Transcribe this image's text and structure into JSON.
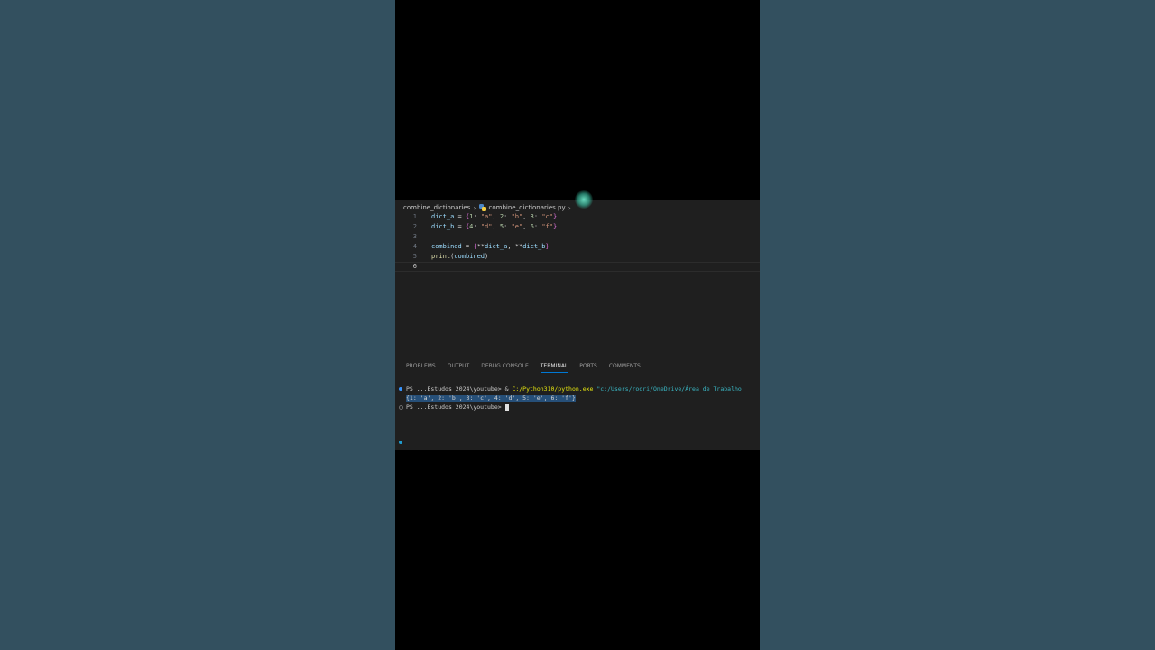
{
  "breadcrumb": {
    "folder": "combine_dictionaries",
    "file": "combine_dictionaries.py",
    "more": "..."
  },
  "editor": {
    "lines": [
      {
        "num": "1",
        "code": "dict_a = {1: \"a\", 2: \"b\", 3: \"c\"}"
      },
      {
        "num": "2",
        "code": "dict_b = {4: \"d\", 5: \"e\", 6: \"f\"}"
      },
      {
        "num": "3",
        "code": ""
      },
      {
        "num": "4",
        "code": "combined = {**dict_a, **dict_b}"
      },
      {
        "num": "5",
        "code": "print(combined)"
      },
      {
        "num": "6",
        "code": ""
      }
    ]
  },
  "panel": {
    "tabs": [
      {
        "label": "PROBLEMS"
      },
      {
        "label": "OUTPUT"
      },
      {
        "label": "DEBUG CONSOLE"
      },
      {
        "label": "TERMINAL",
        "active": true
      },
      {
        "label": "PORTS"
      },
      {
        "label": "COMMENTS"
      }
    ]
  },
  "terminal": {
    "prompt": "PS ...Estudos 2024\\youtube>",
    "amp": "&",
    "exe": "C:/Python310/python.exe",
    "arg": "\"c:/Users/rodri/OneDrive/Área de Trabalho",
    "output": "{1: 'a', 2: 'b', 3: 'c', 4: 'd', 5: 'e', 6: 'f'}"
  },
  "colors": {
    "background": "#33505f",
    "editor_bg": "#1f1f1f",
    "accent": "#0078d4",
    "selection": "#264f78"
  }
}
